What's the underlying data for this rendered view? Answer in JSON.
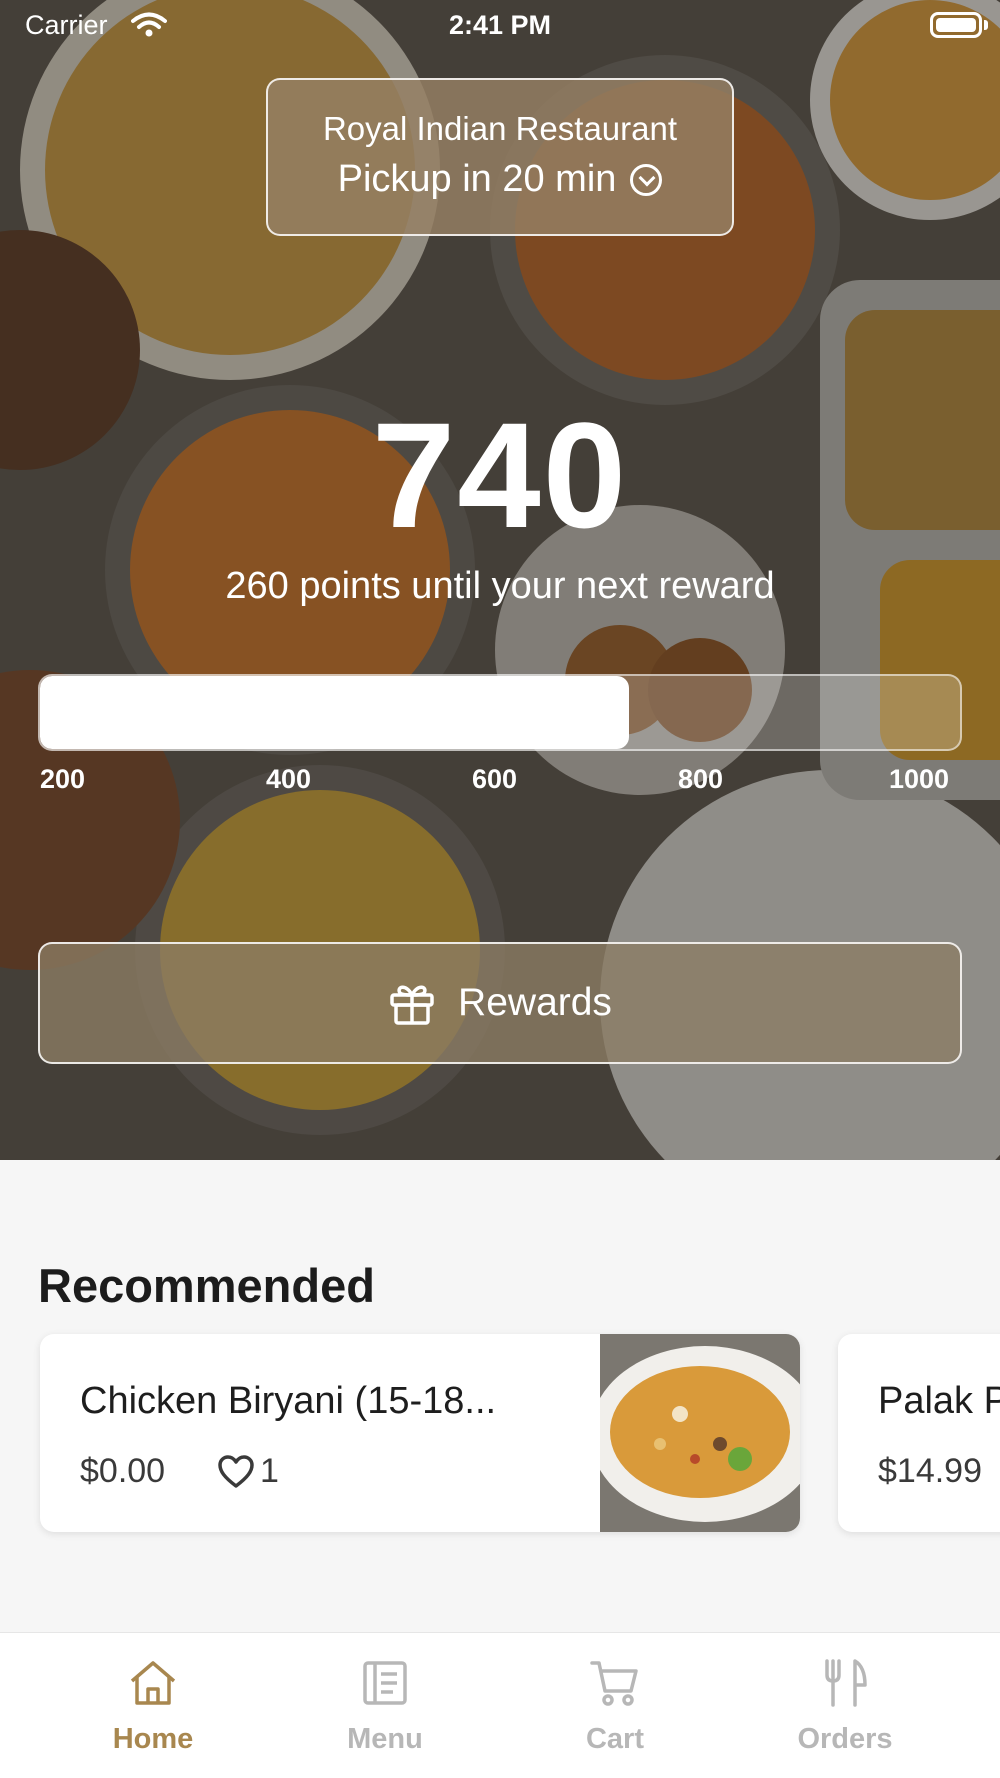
{
  "status_bar": {
    "carrier": "Carrier",
    "time": "2:41 PM",
    "wifi_icon": "wifi-icon",
    "battery_icon": "battery-icon"
  },
  "location": {
    "restaurant": "Royal Indian Restaurant",
    "pickup": "Pickup in 20 min",
    "icon": "chevron-circle-icon"
  },
  "loyalty": {
    "points": "740",
    "caption": "260 points until your next reward",
    "progress_fraction": 0.64,
    "ticks": [
      "200",
      "400",
      "600",
      "800",
      "1000"
    ]
  },
  "rewards_button": {
    "label": "Rewards",
    "icon": "gift-icon"
  },
  "recommended": {
    "title": "Recommended",
    "items": [
      {
        "name": "Chicken Biryani (15-18...",
        "price": "$0.00",
        "likes": "1"
      },
      {
        "name": "Palak P",
        "price": "$14.99"
      }
    ]
  },
  "tabs": [
    {
      "label": "Home",
      "icon": "home-icon",
      "active": true
    },
    {
      "label": "Menu",
      "icon": "menu-icon",
      "active": false
    },
    {
      "label": "Cart",
      "icon": "cart-icon",
      "active": false
    },
    {
      "label": "Orders",
      "icon": "utensils-icon",
      "active": false
    }
  ],
  "colors": {
    "accent": "#a8874f",
    "inactive_tab": "#b7b7b7"
  }
}
